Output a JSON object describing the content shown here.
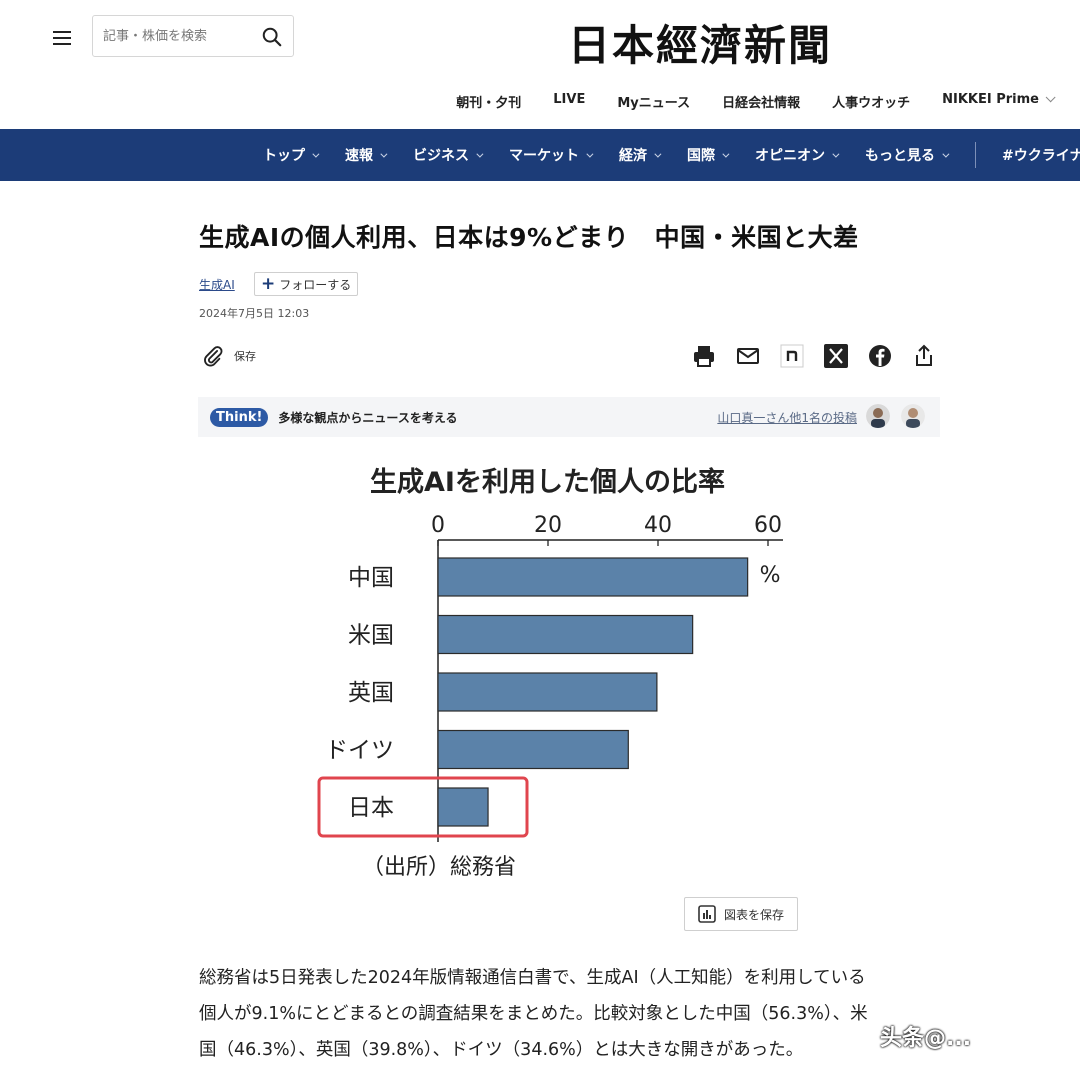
{
  "header": {
    "search_placeholder": "記事・株価を検索",
    "logo": "日本經濟新聞",
    "subnav": [
      "朝刊・夕刊",
      "LIVE",
      "Myニュース",
      "日経会社情報",
      "人事ウオッチ",
      "NIKKEI Prime"
    ]
  },
  "mainnav": {
    "items": [
      "トップ",
      "速報",
      "ビジネス",
      "マーケット",
      "経済",
      "国際",
      "オピニオン",
      "もっと見る"
    ],
    "extra": "#ウクライナ"
  },
  "article": {
    "headline": "生成AIの個人利用、日本は9%どまり　中国・米国と大差",
    "topic": "生成AI",
    "follow_label": "フォローする",
    "date": "2024年7月5日 12:03",
    "save_label": "保存",
    "think_badge": "Think!",
    "think_text": "多様な観点からニュースを考える",
    "think_poster": "山口真一さん他1名の投稿",
    "save_chart_label": "図表を保存",
    "body_line1": "総務省は5日発表した2024年版情報通信白書で、生成AI（人工知能）を利用している",
    "body_line2": "個人が9.1%にとどまるとの調査結果をまとめた。比較対象とした中国（56.3%）、米",
    "body_line3": "国（46.3%）、英国（39.8%）、ドイツ（34.6%）とは大きな開きがあった。"
  },
  "chart_data": {
    "type": "bar",
    "orientation": "horizontal",
    "title": "生成AIを利用した個人の比率",
    "categories": [
      "中国",
      "米国",
      "英国",
      "ドイツ",
      "日本"
    ],
    "values": [
      56.3,
      46.3,
      39.8,
      34.6,
      9.1
    ],
    "xlim": [
      0,
      60
    ],
    "xticks": [
      "0",
      "20",
      "40",
      "60"
    ],
    "unit": "%",
    "source": "（出所）総務省",
    "bar_color": "#5b82a9",
    "highlight": "日本",
    "highlight_color": "#e0454e"
  },
  "watermark": "头条@..."
}
